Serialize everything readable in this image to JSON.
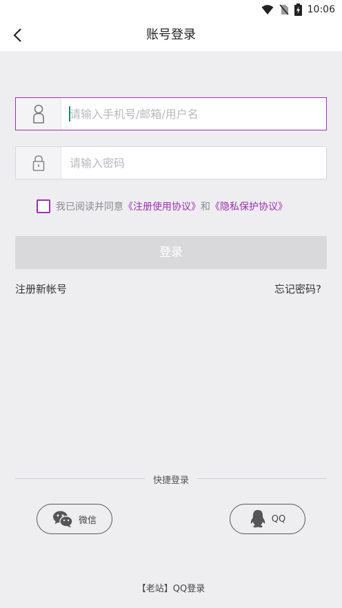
{
  "status": {
    "time": "10:06",
    "icons": [
      "wifi-icon",
      "no-sim-icon",
      "battery-charging-icon"
    ]
  },
  "header": {
    "title": "账号登录",
    "back_icon": "chevron-left-icon"
  },
  "form": {
    "username": {
      "placeholder": "请输入手机号/邮箱/用户名",
      "value": "",
      "icon": "user-icon"
    },
    "password": {
      "placeholder": "请输入密码",
      "value": "",
      "icon": "lock-icon"
    },
    "agreement": {
      "prefix": "我已阅读并同意",
      "terms_link": "《注册使用协议》",
      "and": "和",
      "privacy_link": "《隐私保护协议》",
      "checked": false
    },
    "login_label": "登录",
    "register_link": "注册新帐号",
    "forgot_link": "忘记密码?"
  },
  "quick_login": {
    "label": "快捷登录",
    "wechat_label": "微信",
    "qq_label": "QQ"
  },
  "footer": {
    "old_site": "【老站】QQ登录"
  },
  "colors": {
    "accent": "#9b2fb0",
    "background": "#eeeef0",
    "disabled_button": "#d9d9dc",
    "caret": "#14857a"
  }
}
